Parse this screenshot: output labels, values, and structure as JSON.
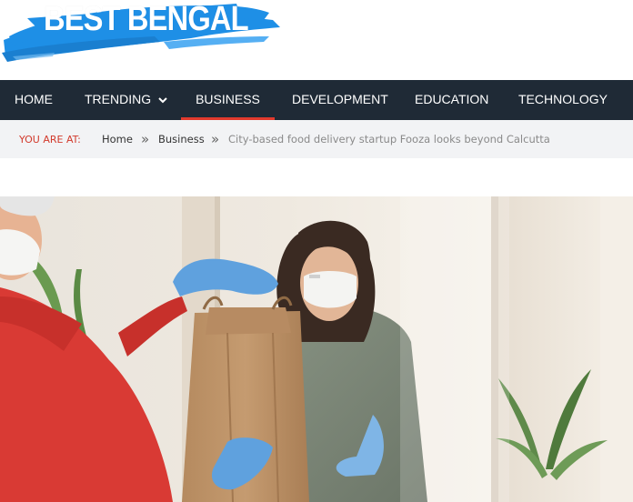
{
  "site": {
    "logo_text": "BEST BENGAL"
  },
  "nav": {
    "items": [
      {
        "label": "HOME"
      },
      {
        "label": "TRENDING"
      },
      {
        "label": "BUSINESS"
      },
      {
        "label": "DEVELOPMENT"
      },
      {
        "label": "EDUCATION"
      },
      {
        "label": "TECHNOLOGY"
      }
    ],
    "active": "BUSINESS"
  },
  "breadcrumb": {
    "lead": "YOU ARE AT:",
    "home": "Home",
    "category": "Business",
    "current": "City-based food delivery startup Fooza looks beyond Calcutta"
  },
  "colors": {
    "nav_bg": "#1f2a36",
    "accent": "#e23a2d",
    "logo_blue": "#1e8fe6"
  },
  "icons": {
    "dropdown": "chevron-down-icon",
    "separator": "double-chevron-right-icon"
  }
}
